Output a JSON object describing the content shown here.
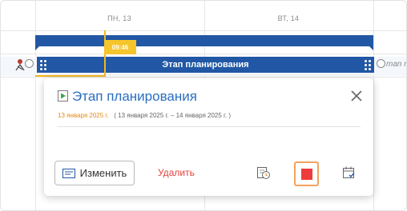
{
  "timeline": {
    "days": [
      "ПН, 13",
      "ВТ, 14"
    ],
    "now_time": "09:46",
    "task_bar_label": "Этап планирования",
    "assignee_text": "man n"
  },
  "popup": {
    "title": "Этап планирования",
    "date_main": "13 января 2025 г.",
    "date_range": "( 13 января 2025 г. – 14 января 2025 г. )",
    "edit_label": "Изменить",
    "delete_label": "Удалить"
  },
  "colors": {
    "bar_blue": "#2157a4",
    "now_yellow": "#f5c52b",
    "title_blue": "#2a6ebf",
    "date_orange": "#e08a1a",
    "delete_red": "#e3433b",
    "stop_red": "#ef3b3b",
    "highlight_orange": "#f2a35e"
  },
  "icons": {
    "title_icon": "play-task-icon",
    "close": "close-icon",
    "edit": "edit-form-icon",
    "history": "time-history-icon",
    "stop": "stop-icon",
    "calendar": "calendar-check-icon"
  }
}
